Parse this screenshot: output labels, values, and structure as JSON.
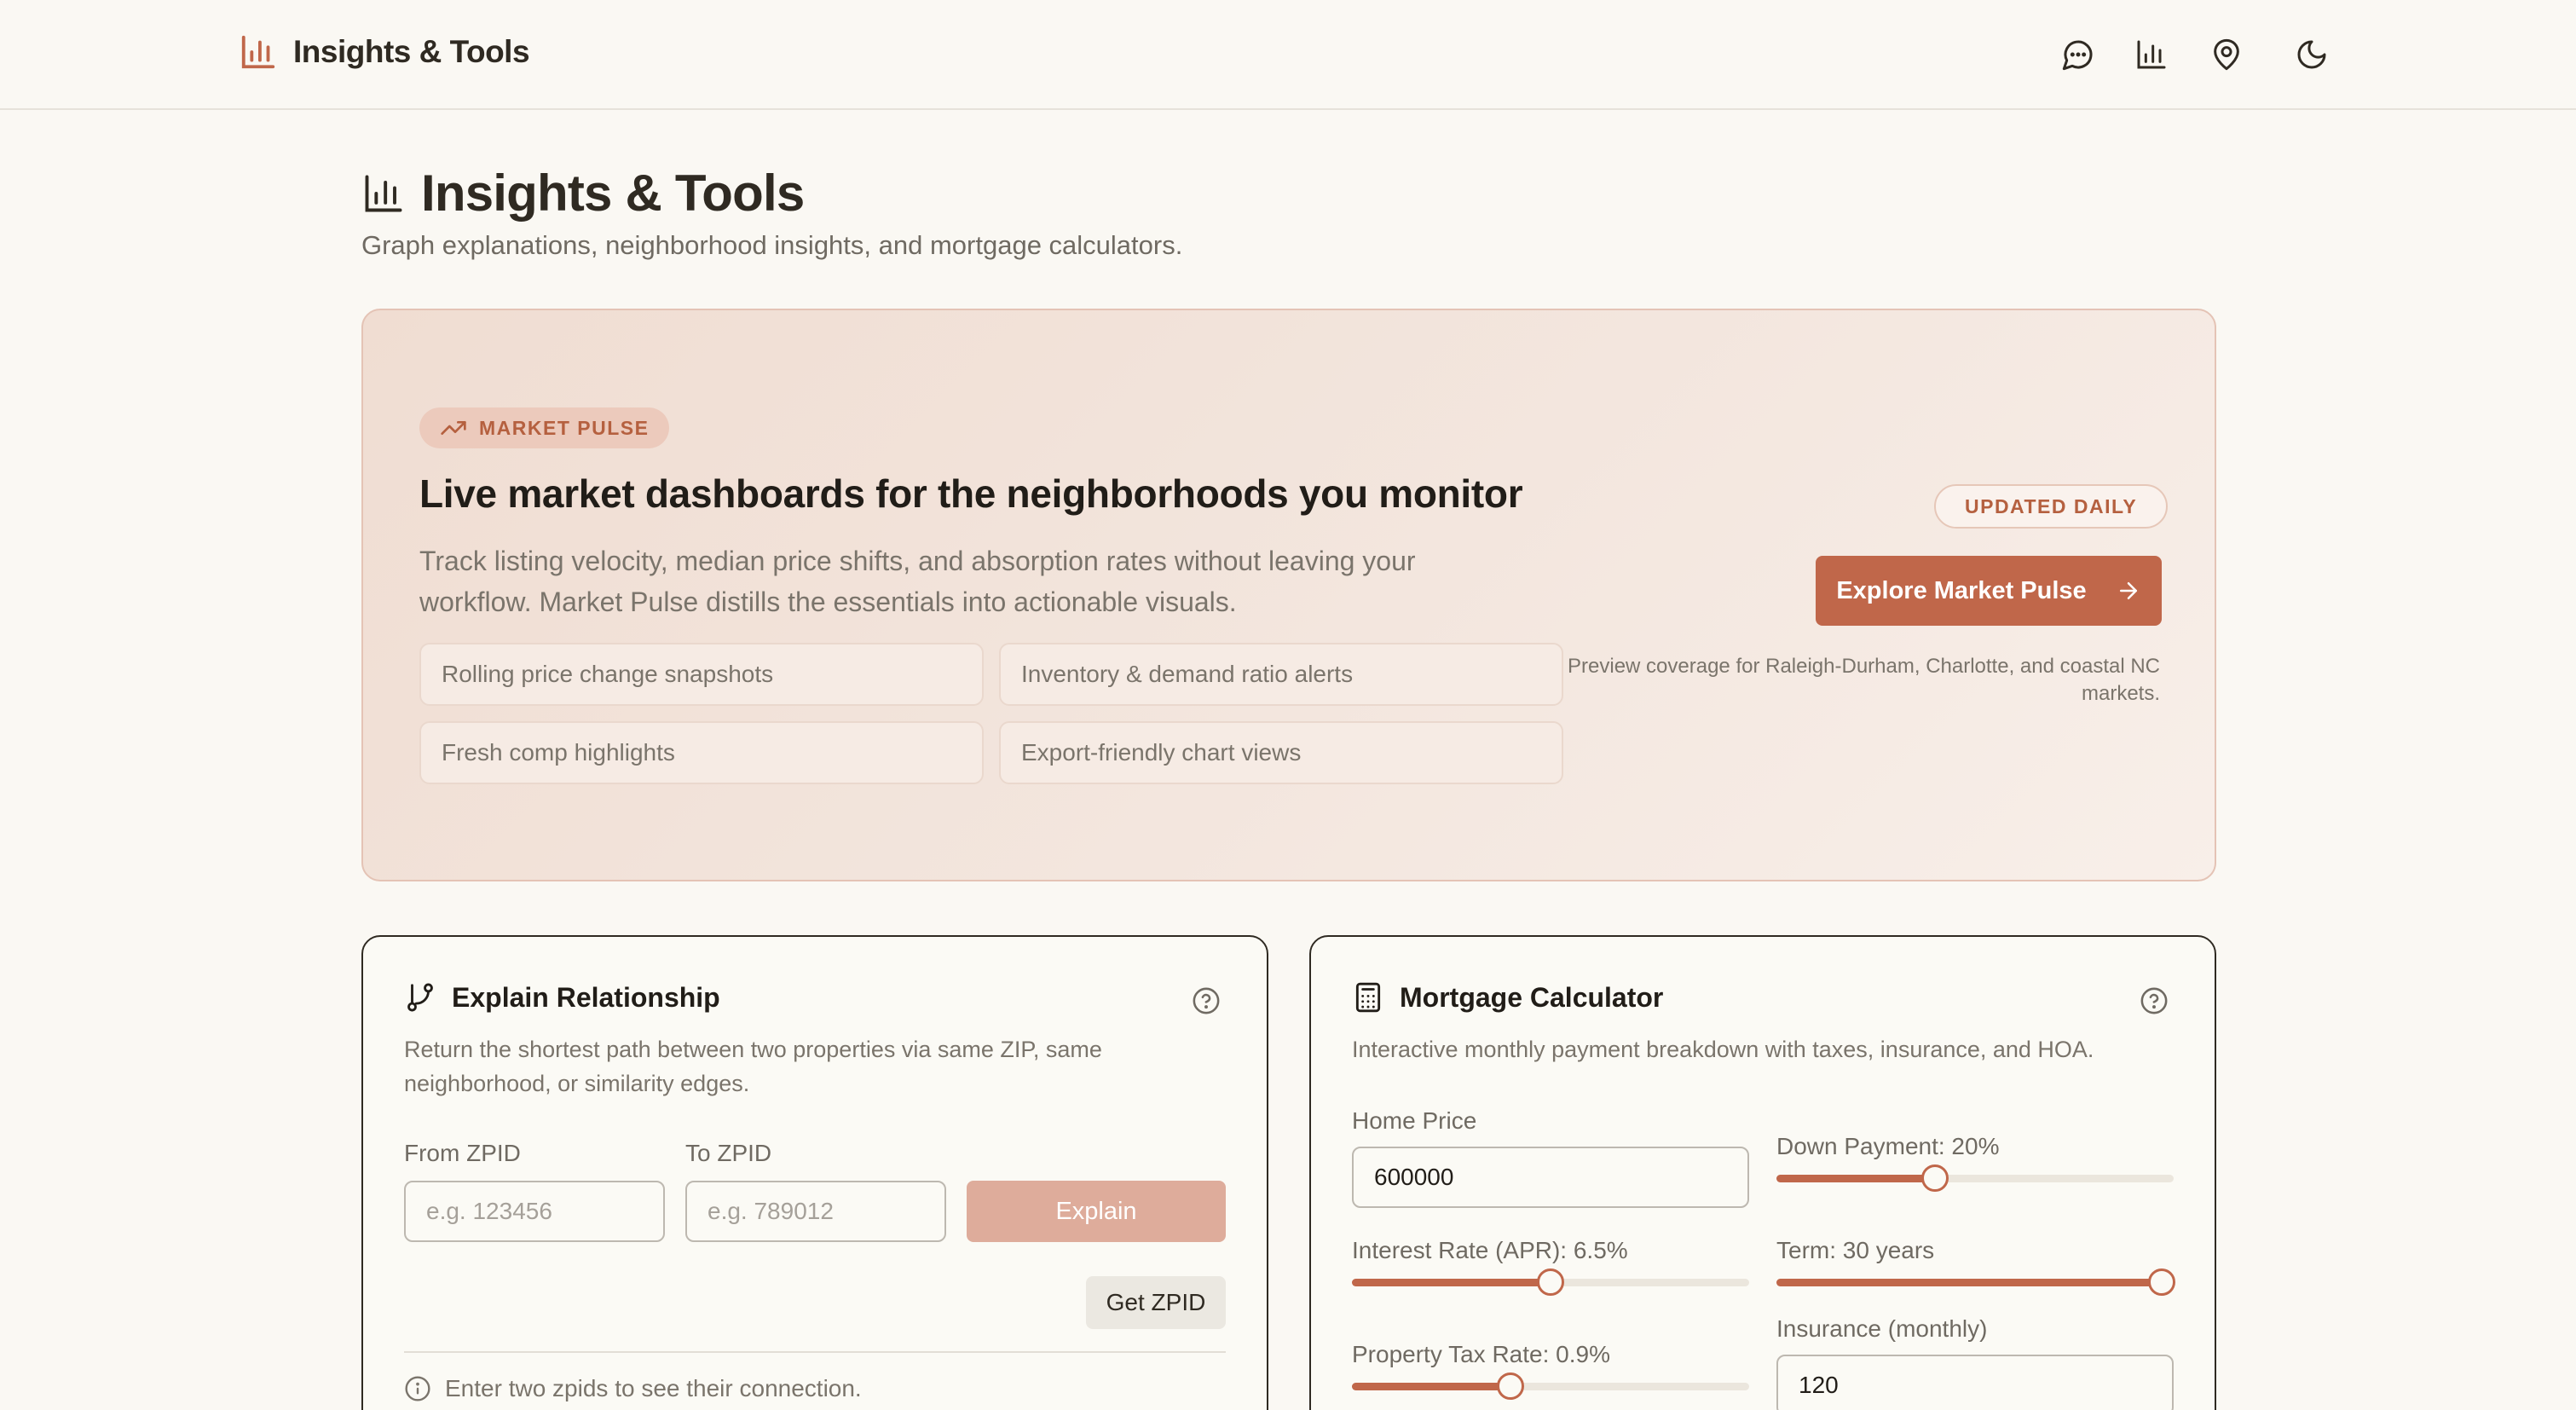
{
  "app": {
    "brand": "Insights & Tools"
  },
  "nav": {
    "icons": [
      "chat-icon",
      "bar-chart-icon",
      "map-pin-icon",
      "moon-icon"
    ]
  },
  "page": {
    "title": "Insights & Tools",
    "subtitle": "Graph explanations, neighborhood insights, and mortgage calculators."
  },
  "pulse": {
    "tag": "MARKET PULSE",
    "heading": "Live market dashboards for the neighborhoods you monitor",
    "description": "Track listing velocity, median price shifts, and absorption rates without leaving your workflow. Market Pulse distills the essentials into actionable visuals.",
    "features": [
      "Rolling price change snapshots",
      "Inventory & demand ratio alerts",
      "Fresh comp highlights",
      "Export-friendly chart views"
    ],
    "badge": "UPDATED DAILY",
    "cta": "Explore Market Pulse",
    "note": "Preview coverage for Raleigh-Durham, Charlotte, and coastal NC markets.",
    "accent_color": "#c0674a"
  },
  "explain": {
    "title": "Explain Relationship",
    "description": "Return the shortest path between two properties via same ZIP, same neighborhood, or similarity edges.",
    "from_label": "From ZPID",
    "from_placeholder": "e.g. 123456",
    "from_value": "",
    "to_label": "To ZPID",
    "to_placeholder": "e.g. 789012",
    "to_value": "",
    "explain_button": "Explain",
    "get_zpid_button": "Get ZPID",
    "hint": "Enter two zpids to see their connection."
  },
  "mortgage": {
    "title": "Mortgage Calculator",
    "description": "Interactive monthly payment breakdown with taxes, insurance, and HOA.",
    "home_price_label": "Home Price",
    "home_price_value": "600000",
    "down_payment_label": "Down Payment: 20%",
    "down_payment_fraction": 0.4,
    "interest_label": "Interest Rate (APR): 6.5%",
    "interest_fraction": 0.5,
    "term_label": "Term: 30 years",
    "term_fraction": 1.0,
    "tax_label": "Property Tax Rate: 0.9%",
    "tax_fraction": 0.4,
    "insurance_label": "Insurance (monthly)",
    "insurance_value": "120"
  }
}
